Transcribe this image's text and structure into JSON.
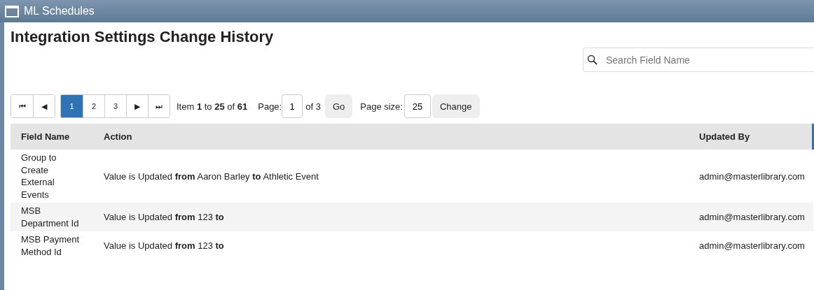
{
  "window": {
    "title": "ML Schedules"
  },
  "page_title": "Integration Settings Change History",
  "search": {
    "placeholder": "Search Field Name"
  },
  "pager": {
    "first": "⏮",
    "prev": "◀",
    "pages": [
      {
        "label": "1",
        "selected": true
      },
      {
        "label": "2",
        "selected": false
      },
      {
        "label": "3",
        "selected": false
      }
    ],
    "next": "▶",
    "last": "⏭",
    "summary": "Item **1** to **25** of **61**",
    "page_label": "Page:",
    "page_value": "1",
    "page_of": "of 3",
    "go": "Go",
    "size_label": "Page size:",
    "size_value": "25",
    "change": "Change"
  },
  "table": {
    "columns": [
      "Field Name",
      "Action",
      "Updated By"
    ],
    "rows": [
      {
        "field": "Group to Create External Events",
        "action": "Value is Updated **from** Aaron Barley **to** Athletic Event",
        "updated_by": "admin@masterlibrary.com"
      },
      {
        "field": "MSB Department Id",
        "action": "Value is Updated **from** 123 **to**",
        "updated_by": "admin@masterlibrary.com"
      },
      {
        "field": "MSB Payment Method Id",
        "action": "Value is Updated **from** 123 **to**",
        "updated_by": "admin@masterlibrary.com"
      }
    ]
  }
}
